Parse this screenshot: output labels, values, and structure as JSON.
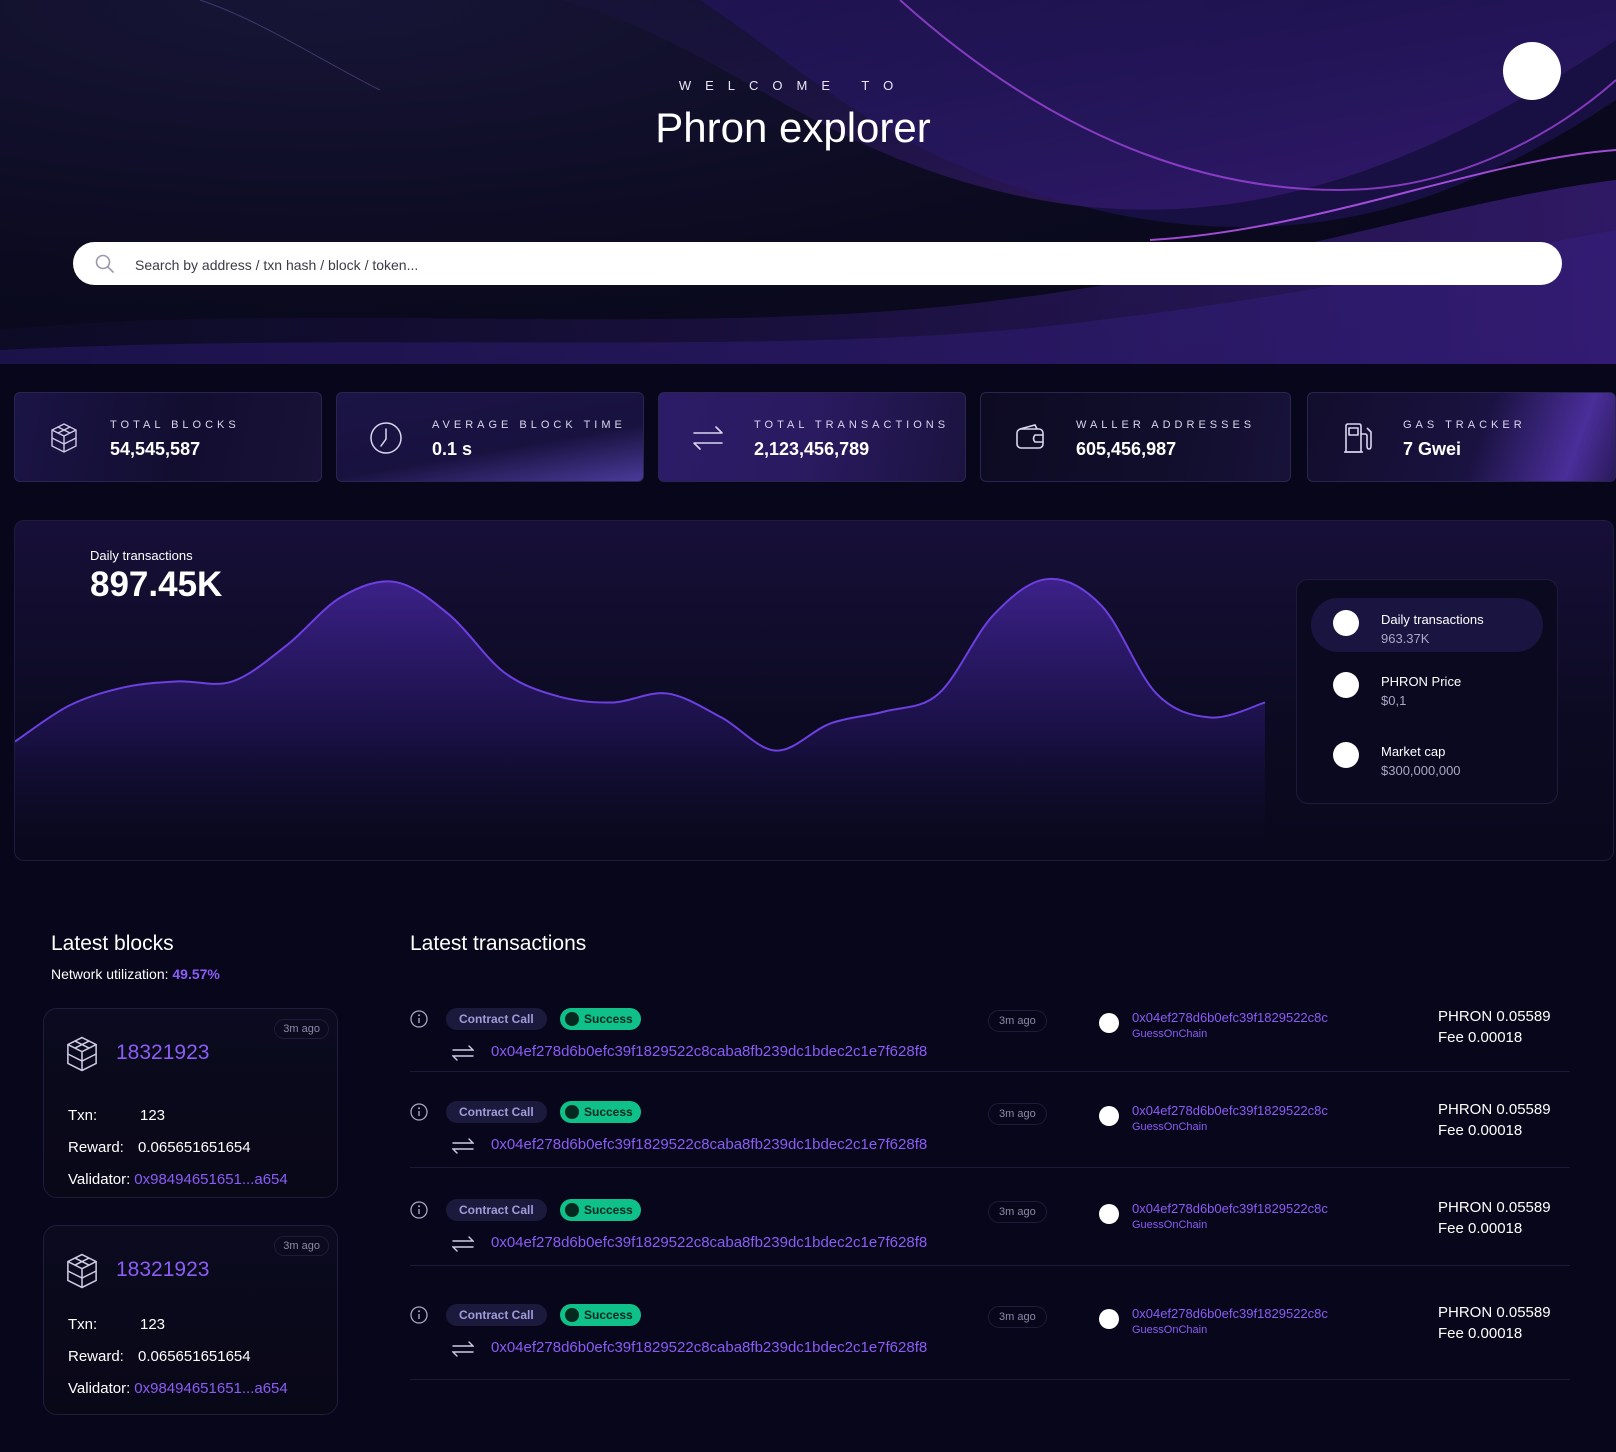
{
  "hero": {
    "welcome": "WELCOME TO",
    "title": "Phron explorer",
    "search_placeholder": "Search by address / txn hash / block / token..."
  },
  "stats": [
    {
      "label": "TOTAL BLOCKS",
      "value": "54,545,587",
      "icon": "cube-icon"
    },
    {
      "label": "AVERAGE BLOCK TIME",
      "value": "0.1 s",
      "icon": "clock-icon"
    },
    {
      "label": "TOTAL TRANSACTIONS",
      "value": "2,123,456,789",
      "icon": "swap-arrows-icon"
    },
    {
      "label": "WALLER ADDRESSES",
      "value": "605,456,987",
      "icon": "wallet-icon"
    },
    {
      "label": "GAS TRACKER",
      "value": "7 Gwei",
      "icon": "gas-pump-icon"
    }
  ],
  "chart": {
    "label": "Daily transactions",
    "value": "897.45K",
    "legend": [
      {
        "title": "Daily transactions",
        "value": "963.37K"
      },
      {
        "title": "PHRON Price",
        "value": "$0,1"
      },
      {
        "title": "Market cap",
        "value": "$300,000,000"
      }
    ]
  },
  "chart_data": {
    "type": "area",
    "title": "",
    "xlabel": "",
    "ylabel": "",
    "grid": false,
    "series": [
      {
        "values": [
          40,
          52,
          58,
          60,
          60,
          72,
          88,
          93,
          82,
          63,
          55,
          53,
          56,
          48,
          37,
          46,
          50,
          56,
          82,
          94,
          85,
          56,
          48,
          53
        ]
      }
    ]
  },
  "blocks": {
    "title": "Latest blocks",
    "net_label": "Network utilization: ",
    "net_value": "49.57%",
    "items": [
      {
        "number": "18321923",
        "ago": "3m ago",
        "txn_label": "Txn:",
        "txn": "123",
        "reward_label": "Reward:",
        "reward": "0.065651651654",
        "validator_label": "Validator:",
        "validator": "0x98494651651...a654"
      },
      {
        "number": "18321923",
        "ago": "3m ago",
        "txn_label": "Txn:",
        "txn": "123",
        "reward_label": "Reward:",
        "reward": "0.065651651654",
        "validator_label": "Validator:",
        "validator": "0x98494651651...a654"
      }
    ]
  },
  "transactions": {
    "title": "Latest transactions",
    "items": [
      {
        "type": "Contract Call",
        "status": "Success",
        "hash": "0x04ef278d6b0efc39f1829522c8caba8fb239dc1bdec2c1e7f628f8",
        "ago": "3m ago",
        "address": "0x04ef278d6b0efc39f1829522c8c",
        "tag": "GuessOnChain",
        "amount": "PHRON 0.05589",
        "fee": "Fee 0.00018"
      },
      {
        "type": "Contract Call",
        "status": "Success",
        "hash": "0x04ef278d6b0efc39f1829522c8caba8fb239dc1bdec2c1e7f628f8",
        "ago": "3m ago",
        "address": "0x04ef278d6b0efc39f1829522c8c",
        "tag": "GuessOnChain",
        "amount": "PHRON 0.05589",
        "fee": "Fee 0.00018"
      },
      {
        "type": "Contract Call",
        "status": "Success",
        "hash": "0x04ef278d6b0efc39f1829522c8caba8fb239dc1bdec2c1e7f628f8",
        "ago": "3m ago",
        "address": "0x04ef278d6b0efc39f1829522c8c",
        "tag": "GuessOnChain",
        "amount": "PHRON 0.05589",
        "fee": "Fee 0.00018"
      },
      {
        "type": "Contract Call",
        "status": "Success",
        "hash": "0x04ef278d6b0efc39f1829522c8caba8fb239dc1bdec2c1e7f628f8",
        "ago": "3m ago",
        "address": "0x04ef278d6b0efc39f1829522c8c",
        "tag": "GuessOnChain",
        "amount": "PHRON 0.05589",
        "fee": "Fee 0.00018"
      }
    ]
  },
  "colors": {
    "accent": "#8b5cf6",
    "success": "#10c089",
    "background": "#07061a"
  }
}
